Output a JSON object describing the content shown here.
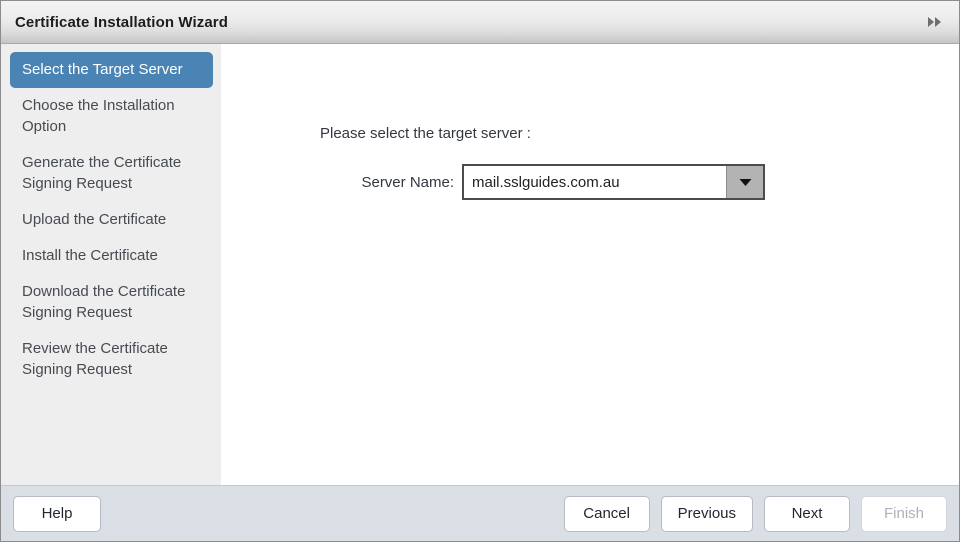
{
  "window": {
    "title": "Certificate Installation Wizard",
    "expand_icon": "double-chevron-right-icon"
  },
  "sidebar": {
    "items": [
      {
        "label": "Select the Target Server",
        "active": true
      },
      {
        "label": "Choose the Installation Option",
        "active": false
      },
      {
        "label": "Generate the Certificate Signing Request",
        "active": false
      },
      {
        "label": "Upload the Certificate",
        "active": false
      },
      {
        "label": "Install the Certificate",
        "active": false
      },
      {
        "label": "Download the Certificate Signing Request",
        "active": false
      },
      {
        "label": "Review the Certificate Signing Request",
        "active": false
      }
    ]
  },
  "main": {
    "prompt": "Please select the target server :",
    "server_name_label": "Server Name:",
    "server_name_value": "mail.sslguides.com.au",
    "dropdown_icon": "triangle-down-icon"
  },
  "footer": {
    "help_label": "Help",
    "cancel_label": "Cancel",
    "previous_label": "Previous",
    "next_label": "Next",
    "finish_label": "Finish",
    "finish_disabled": true
  },
  "colors": {
    "accent_blue": "#4a84b4",
    "sidebar_bg": "#eeeeee",
    "footer_bg": "#dadee5",
    "text": "#333840"
  }
}
